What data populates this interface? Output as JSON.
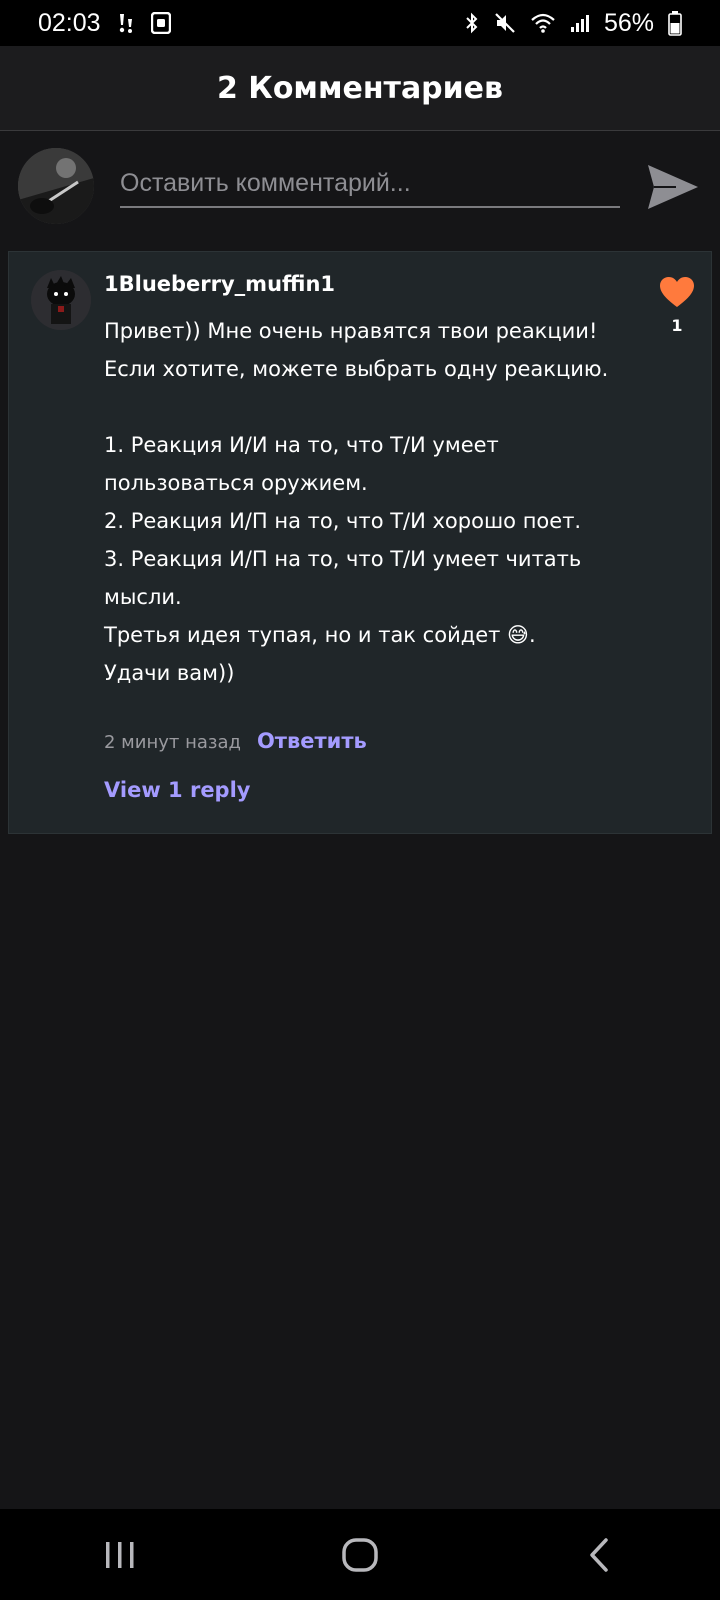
{
  "status_bar": {
    "time": "02:03",
    "battery": "56%",
    "icons": [
      "download-icon",
      "screenshot-icon",
      "bluetooth-icon",
      "mute-icon",
      "wifi-icon",
      "signal-icon",
      "battery-icon"
    ]
  },
  "header": {
    "title": "2 Комментариев"
  },
  "composer": {
    "placeholder": "Оставить комментарий...",
    "send_icon": "send-icon"
  },
  "comment": {
    "username": "1Blueberry_muffin1",
    "body": "Привет)) Мне очень нравятся твои реакции! Если хотите, можете выбрать одну реакцию.\n\n1. Реакция И/И на то, что Т/И умеет пользоваться оружием.\n2. Реакция И/П на то, что Т/И хорошо поет.\n3. Реакция И/П на то, что Т/И умеет читать мысли.\nТретья идея тупая, но и так сойдет 😅.\nУдачи вам))",
    "likes": "1",
    "time": "2 минут назад",
    "reply_label": "Ответить",
    "view_replies_label": "View 1 reply",
    "like_icon": "heart-icon",
    "like_color": "#ff7a3d",
    "link_color": "#a49bff"
  },
  "nav_bar": {
    "icons": [
      "recent-apps-icon",
      "home-icon",
      "back-icon"
    ]
  }
}
